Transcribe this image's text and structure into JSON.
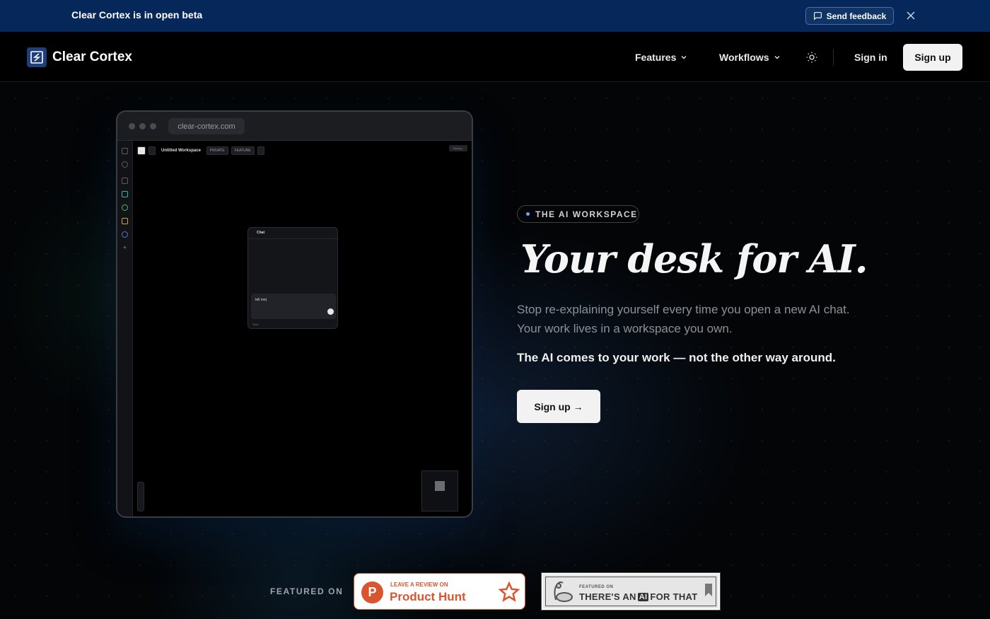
{
  "banner": {
    "text": "Clear Cortex is in open beta",
    "feedback_label": "Send feedback"
  },
  "nav": {
    "brand": "Clear Cortex",
    "items": [
      {
        "label": "Features"
      },
      {
        "label": "Workflows"
      }
    ],
    "signin_label": "Sign in",
    "signup_label": "Sign up"
  },
  "mock": {
    "url": "clear-cortex.com",
    "workspace_title": "Untitled Workspace",
    "private_label": "PRIVATE",
    "feature_label": "FEATURE",
    "saving_label": "Saving...",
    "chat_title": "Chat",
    "chat_input": "tell me|",
    "chat_footer": "Todo"
  },
  "hero": {
    "eyebrow": "THE AI WORKSPACE",
    "title": "Your desk for AI.",
    "subtitle": "Stop re-explaining yourself every time you open a new AI chat. Your work lives in a workspace you own.",
    "strong": "The AI comes to your work — not the other way around.",
    "cta_label": "Sign up →"
  },
  "featured": {
    "label": "FEATURED ON",
    "product_hunt": {
      "small": "LEAVE A REVIEW ON",
      "big": "Product Hunt",
      "logo_letter": "P"
    },
    "taaft": {
      "small": "FEATURED ON",
      "pre": "THERE'S AN",
      "ai": "AI",
      "post": "FOR THAT"
    }
  },
  "colors": {
    "banner_bg": "#06275a",
    "product_hunt": "#da552f",
    "cta_bg": "#f2f2f2"
  }
}
